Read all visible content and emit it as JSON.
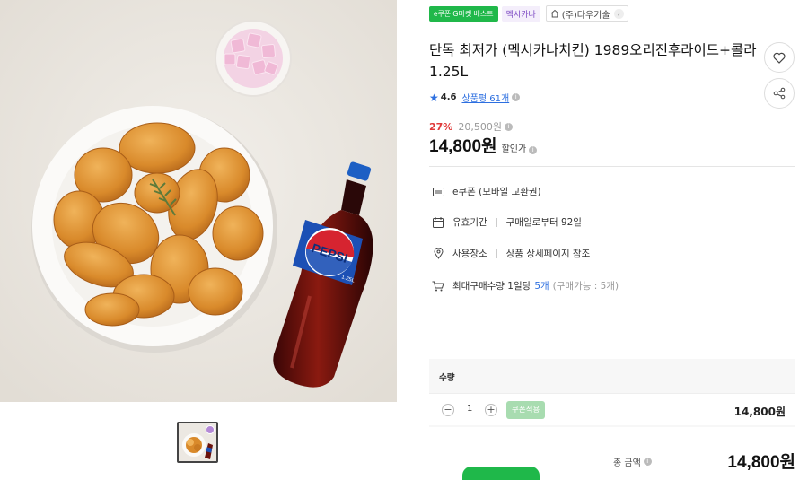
{
  "product": {
    "tag_main": "e쿠폰 G마켓 베스트",
    "tag_brand": "멕시카나",
    "seller": "(주)다우기술",
    "title": "단독 최저가 (멕시카나치킨) 1989오리진후라이드+콜라1.25L",
    "rating": "4.6",
    "reviews": "상품평 61개",
    "discount": "27%",
    "original_price": "20,500원",
    "sale_price": "14,800원",
    "sale_label": "할인가"
  },
  "image": {
    "bottle_label": "PEPSI",
    "bottle_sub": "1.25L"
  },
  "details": {
    "type": "e쿠폰 (모바일 교환권)",
    "validity_label": "유효기간",
    "validity_value": "구매일로부터 92일",
    "place_label": "사용장소",
    "place_value": "상품 상세페이지 참조",
    "limit_label": "최대구매수량 1일당",
    "limit_value": "5개",
    "limit_note": "(구매가능 : 5개)"
  },
  "purchase": {
    "qty_title": "수량",
    "minus": "−",
    "plus": "+",
    "quantity": "1",
    "coupon_button": "쿠폰적용",
    "qty_price": "14,800원",
    "total_label": "총 금액",
    "total_price": "14,800원"
  },
  "colors": {
    "accent_green": "#1fb84a",
    "discount_red": "#e03a3a",
    "link_blue": "#2d6fe0"
  }
}
